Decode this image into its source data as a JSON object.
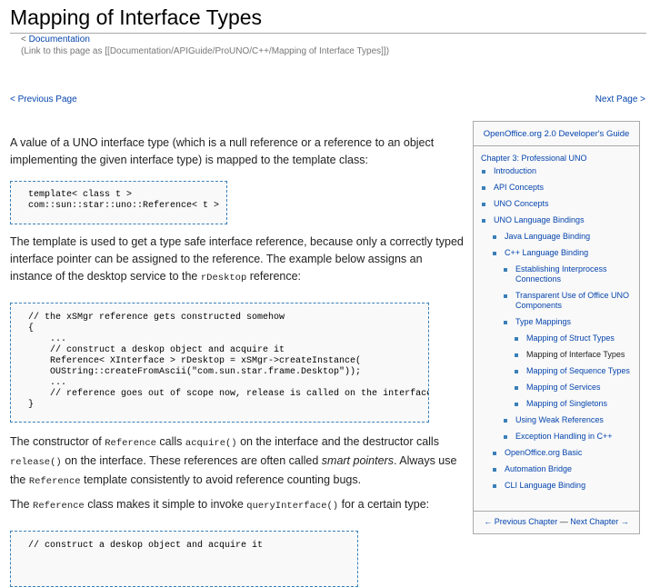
{
  "page": {
    "title": "Mapping of Interface Types",
    "breadcrumb": "Documentation",
    "link_hint": "(Link to this page as [[Documentation/APIGuide/ProUNO/C++/Mapping of Interface Types]])",
    "prev_label": "< Previous Page",
    "next_label": "Next Page >"
  },
  "content": {
    "p1": "A value of a UNO interface type (which is a null reference or a reference to an object implementing the given interface type) is mapped to the template class:",
    "code1": "template< class t >\ncom::sun::star::uno::Reference< t >",
    "p2_a": "The template is used to get a type safe interface reference, because only a correctly typed interface pointer can be assigned to the reference. The example below assigns an instance of the desktop service to the ",
    "p2_code": "rDesktop",
    "p2_b": " reference:",
    "code2": "// the xSMgr reference gets constructed somehow\n{\n    ...\n    // construct a deskop object and acquire it\n    Reference< XInterface > rDesktop = xSMgr->createInstance(\n    OUString::createFromAscii(\"com.sun.star.frame.Desktop\"));\n    ...\n    // reference goes out of scope now, release is called on the interface\n}",
    "p3_a": "The constructor of ",
    "p3_code1": "Reference",
    "p3_b": " calls ",
    "p3_code2": "acquire()",
    "p3_c": " on the interface and the destructor calls ",
    "p3_code3": "release()",
    "p3_d": " on the interface. These references are often called ",
    "p3_em": "smart pointers",
    "p3_e": ". Always use the ",
    "p3_code4": "Reference",
    "p3_f": " template consistently to avoid reference counting bugs.",
    "p4_a": "The ",
    "p4_code1": "Reference",
    "p4_b": " class makes it simple to invoke ",
    "p4_code2": "queryInterface()",
    "p4_c": " for a certain type:",
    "code3": "// construct a deskop object and acquire it"
  },
  "sidebar": {
    "heading": "OpenOffice.org 2.0 Developer's Guide",
    "chapter": "Chapter 3: Professional UNO",
    "items": [
      {
        "label": "Introduction",
        "level": 0
      },
      {
        "label": "API Concepts",
        "level": 0
      },
      {
        "label": "UNO Concepts",
        "level": 0
      },
      {
        "label": "UNO Language Bindings",
        "level": 0
      },
      {
        "label": "Java Language Binding",
        "level": 1
      },
      {
        "label": "C++ Language Binding",
        "level": 1
      },
      {
        "label": "Establishing Interprocess Connections",
        "level": 2
      },
      {
        "label": "Transparent Use of Office UNO Components",
        "level": 2
      },
      {
        "label": "Type Mappings",
        "level": 2
      },
      {
        "label": "Mapping of Struct Types",
        "level": 3
      },
      {
        "label": "Mapping of Interface Types",
        "level": 3,
        "current": true
      },
      {
        "label": "Mapping of Sequence Types",
        "level": 3
      },
      {
        "label": "Mapping of Services",
        "level": 3
      },
      {
        "label": "Mapping of Singletons",
        "level": 3
      },
      {
        "label": "Using Weak References",
        "level": 2
      },
      {
        "label": "Exception Handling in C++",
        "level": 2
      },
      {
        "label": "OpenOffice.org Basic",
        "level": 1
      },
      {
        "label": "Automation Bridge",
        "level": 1
      },
      {
        "label": "CLI Language Binding",
        "level": 1
      }
    ],
    "prev_chapter": "← Previous Chapter",
    "separator": "—",
    "next_chapter": "Next Chapter →"
  },
  "colors": {
    "link": "#0645ad",
    "bullet": "#3b7fb8",
    "code_border": "#3b7fb8",
    "sidebar_bg": "#f9f9f9"
  }
}
